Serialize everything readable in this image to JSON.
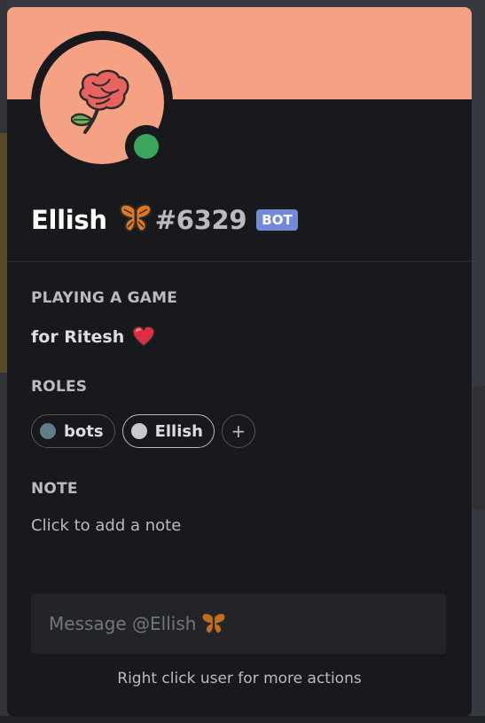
{
  "colors": {
    "banner": "#f4a283",
    "avatar_bg": "#f4a283",
    "status_online": "#3ba55c",
    "bot_tag": "#7289da",
    "role_bots": "#607d8b",
    "role_ellish": "#c7c9cc"
  },
  "profile": {
    "username": "Ellish",
    "name_emoji": "butterfly-emoji",
    "discriminator": "#6329",
    "bot_tag": "BOT",
    "status": "online",
    "avatar_icon": "rose-icon"
  },
  "activity": {
    "title": "PLAYING A GAME",
    "text": "for Ritesh",
    "emoji": "red-heart-emoji"
  },
  "roles": {
    "title": "ROLES",
    "items": [
      {
        "label": "bots"
      },
      {
        "label": "Ellish"
      }
    ],
    "add_label": "+"
  },
  "note": {
    "title": "NOTE",
    "placeholder": "Click to add a note"
  },
  "message": {
    "placeholder": "Message @Ellish"
  },
  "footer": {
    "hint": "Right click user for more actions"
  }
}
